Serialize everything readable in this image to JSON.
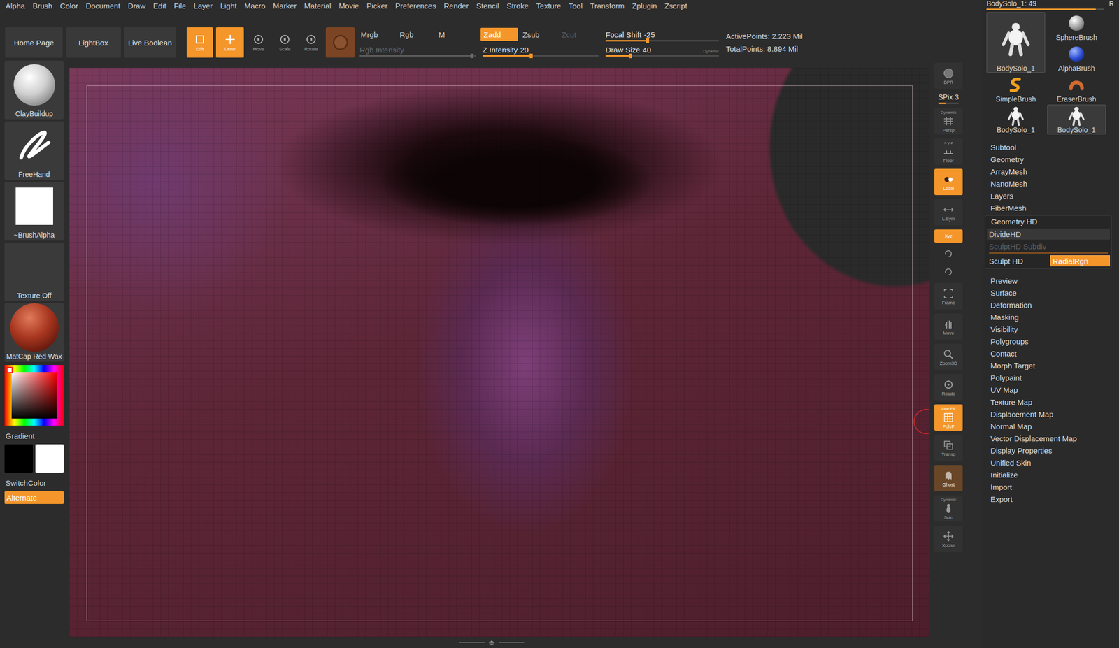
{
  "menu": [
    "Alpha",
    "Brush",
    "Color",
    "Document",
    "Draw",
    "Edit",
    "File",
    "Layer",
    "Light",
    "Macro",
    "Marker",
    "Material",
    "Movie",
    "Picker",
    "Preferences",
    "Render",
    "Stencil",
    "Stroke",
    "Texture",
    "Tool",
    "Transform",
    "Zplugin",
    "Zscript"
  ],
  "shelf": {
    "nav": [
      "Home Page",
      "LightBox",
      "Live Boolean"
    ],
    "modes": [
      {
        "label": "Edit",
        "selected": true
      },
      {
        "label": "Draw",
        "selected": true
      },
      {
        "label": "Move",
        "selected": false
      },
      {
        "label": "Scale",
        "selected": false
      },
      {
        "label": "Rotate",
        "selected": false
      }
    ],
    "rgb_modes": [
      {
        "label": "Mrgb",
        "selected": false,
        "disabled": false
      },
      {
        "label": "Rgb",
        "selected": false,
        "disabled": false
      },
      {
        "label": "M",
        "selected": false,
        "disabled": false
      }
    ],
    "rgb_intensity": {
      "label": "Rgb Intensity",
      "disabled": true,
      "level": 0.97
    },
    "z_modes": [
      {
        "label": "Zadd",
        "selected": true,
        "disabled": false
      },
      {
        "label": "Zsub",
        "selected": false,
        "disabled": false
      },
      {
        "label": "Zcut",
        "selected": false,
        "disabled": true
      }
    ],
    "z_intensity": {
      "label": "Z Intensity",
      "value": "20",
      "disabled": false,
      "level": 0.42
    },
    "focal_shift": {
      "label": "Focal Shift",
      "value": "-25",
      "disabled": false,
      "level": 0.37
    },
    "draw_size": {
      "label": "Draw Size",
      "value": "40",
      "disabled": false,
      "level": 0.22,
      "tag": "Dynamic"
    },
    "stats": [
      {
        "label": "ActivePoints:",
        "value": "2.223 Mil"
      },
      {
        "label": "TotalPoints:",
        "value": "8.894 Mil"
      }
    ]
  },
  "left_shelf": {
    "tiles": [
      {
        "label": "ClayBuildup",
        "kind": "brush"
      },
      {
        "label": "FreeHand",
        "kind": "stroke"
      },
      {
        "label": "~BrushAlpha",
        "kind": "alpha"
      },
      {
        "label": "Texture Off",
        "kind": "texture"
      },
      {
        "label": "MatCap Red Wax",
        "kind": "material"
      }
    ],
    "gradient": "Gradient",
    "swatches": [
      {
        "color": "#000000"
      },
      {
        "color": "#ffffff"
      }
    ],
    "switch_color": "SwitchColor",
    "alternate": {
      "label": "Alternate",
      "on": true
    }
  },
  "right_shelf": [
    {
      "label": "BPR",
      "kind": "button",
      "selected": false,
      "disabled": false
    },
    {
      "label": "SPix 3",
      "kind": "slider",
      "level": 0.35
    },
    {
      "label": "Persp",
      "kind": "button",
      "selected": false,
      "disabled": false,
      "tag": "Dynamic"
    },
    {
      "label": "Floor",
      "kind": "button",
      "selected": false,
      "disabled": false,
      "tag": "x y z"
    },
    {
      "label": "Local",
      "kind": "button",
      "selected": true,
      "disabled": false
    },
    {
      "label": "L.Sym",
      "kind": "button",
      "selected": false,
      "disabled": false
    },
    {
      "label": "Xyz",
      "kind": "toggle",
      "selected": true,
      "disabled": false
    },
    {
      "kind": "mini",
      "selected": false
    },
    {
      "kind": "mini",
      "selected": false
    },
    {
      "label": "Frame",
      "kind": "button",
      "selected": false,
      "disabled": false
    },
    {
      "label": "Move",
      "kind": "button",
      "selected": false,
      "disabled": false
    },
    {
      "label": "Zoom3D",
      "kind": "button",
      "selected": false,
      "disabled": false
    },
    {
      "label": "Rotate",
      "kind": "button",
      "selected": false,
      "disabled": false
    },
    {
      "label": "PolyF",
      "kind": "button",
      "selected": true,
      "disabled": false,
      "tag": "Line Fill"
    },
    {
      "label": "Transp",
      "kind": "button",
      "selected": false,
      "disabled": false
    },
    {
      "label": "Ghost",
      "kind": "button",
      "selected": true,
      "disabled": true
    },
    {
      "label": "Solo",
      "kind": "button",
      "selected": false,
      "disabled": false,
      "tag": "Dynamic"
    },
    {
      "label": "Xpose",
      "kind": "button",
      "selected": false,
      "disabled": false
    }
  ],
  "viewport": {
    "kind": "render",
    "frame": true,
    "brush_cursor": true
  },
  "tool": {
    "title": "BodySolo_1: 49",
    "level": 0.93,
    "reset": "R",
    "thumbs": [
      {
        "label": "BodySolo_1",
        "kind": "figure",
        "large": true,
        "selected": true
      },
      {
        "label": "SphereBrush",
        "kind": "sphere",
        "large": false,
        "selected": false
      },
      {
        "label": "AlphaBrush",
        "kind": "alpha",
        "large": false,
        "selected": false
      },
      {
        "label": "SimpleBrush",
        "kind": "simple",
        "large": false,
        "selected": false
      },
      {
        "label": "EraserBrush",
        "kind": "eraser",
        "large": false,
        "selected": false
      },
      {
        "label": "BodySolo_1",
        "kind": "figure",
        "large": false,
        "selected": false
      },
      {
        "label": "BodySolo_1",
        "kind": "figure",
        "large": false,
        "selected": true
      }
    ],
    "menu_top": [
      "Subtool",
      "Geometry",
      "ArrayMesh",
      "NanoMesh",
      "Layers",
      "FiberMesh"
    ],
    "geometry_hd": {
      "label": "Geometry HD",
      "expanded": true,
      "divide": "DivideHD",
      "subdiv": {
        "label": "SculptHD Subdiv",
        "disabled": true,
        "level": 1
      },
      "sculpt": "Sculpt HD",
      "radial": {
        "label": "RadialRgn",
        "on": true
      }
    },
    "menu_bottom": [
      "Preview",
      "Surface",
      "Deformation",
      "Masking",
      "Visibility",
      "Polygroups",
      "Contact",
      "Morph Target",
      "Polypaint",
      "UV Map",
      "Texture Map",
      "Displacement Map",
      "Normal Map",
      "Vector Displacement Map",
      "Display Properties",
      "Unified Skin",
      "Initialize",
      "Import",
      "Export"
    ]
  }
}
